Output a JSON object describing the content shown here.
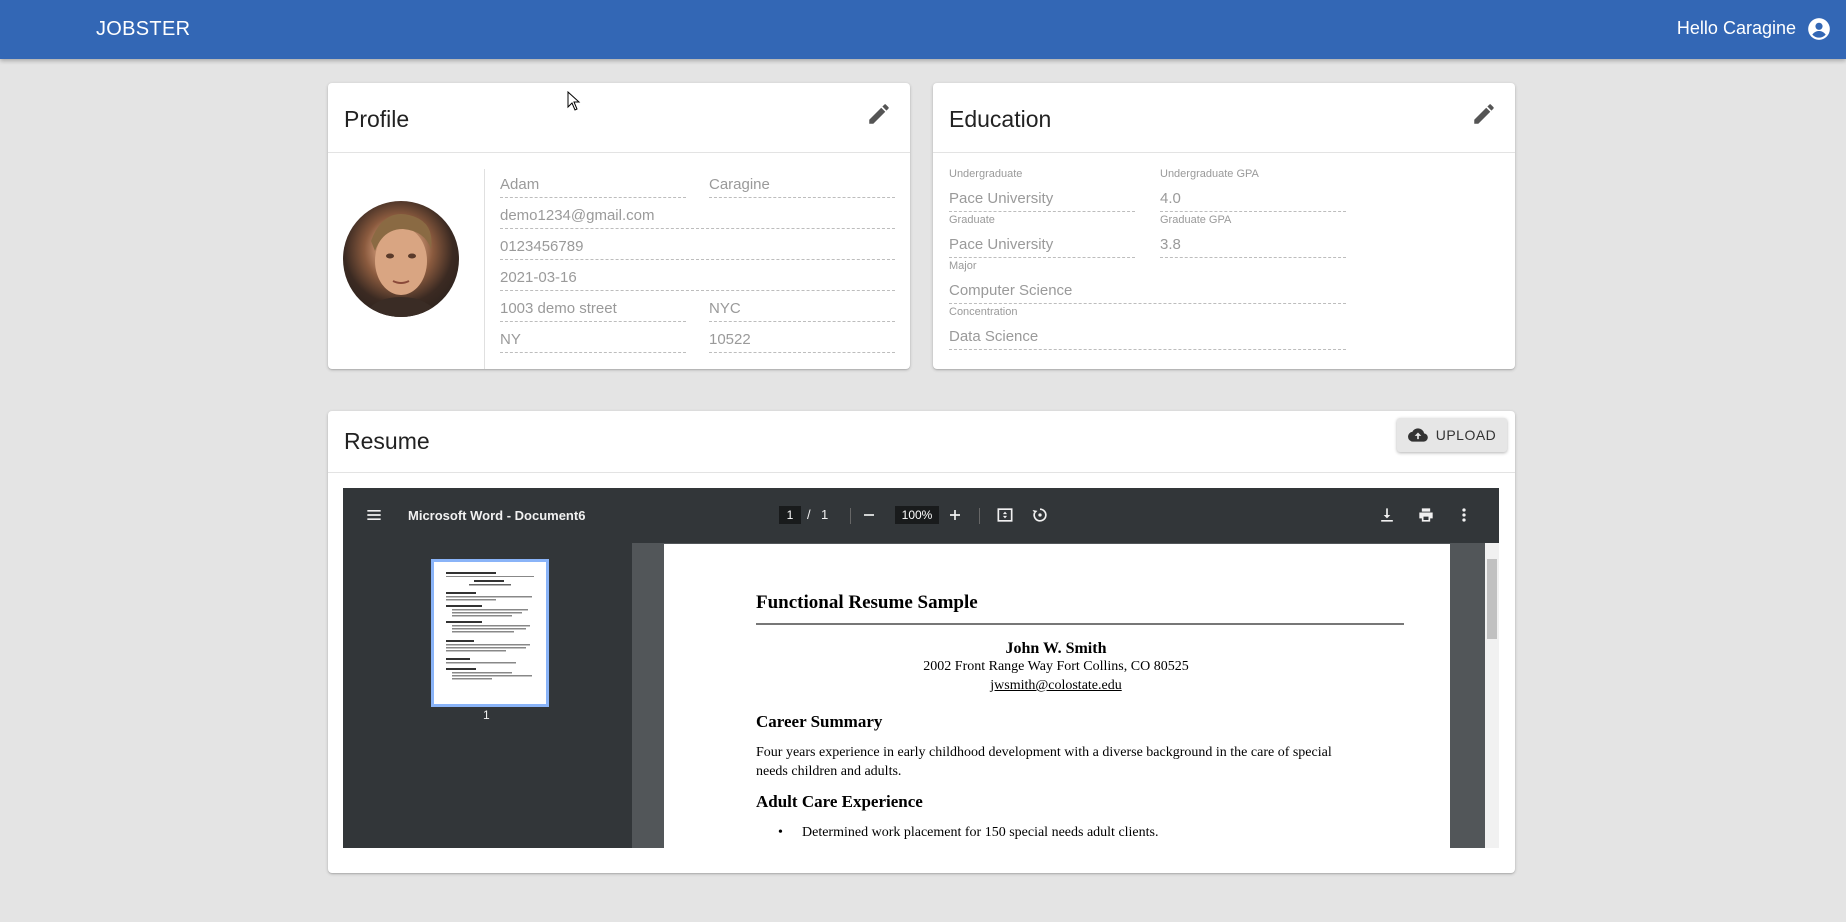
{
  "header": {
    "brand": "JOBSTER",
    "greeting": "Hello Caragine"
  },
  "profile": {
    "title": "Profile",
    "first_name": "Adam",
    "last_name": "Caragine",
    "email": "demo1234@gmail.com",
    "phone": "0123456789",
    "date": "2021-03-16",
    "street": "1003 demo street",
    "city": "NYC",
    "state": "NY",
    "zip": "10522"
  },
  "education": {
    "title": "Education",
    "undergrad_label": "Undergraduate",
    "undergrad_value": "Pace University",
    "undergrad_gpa_label": "Undergraduate GPA",
    "undergrad_gpa_value": "4.0",
    "grad_label": "Graduate",
    "grad_value": "Pace University",
    "grad_gpa_label": "Graduate GPA",
    "grad_gpa_value": "3.8",
    "major_label": "Major",
    "major_value": "Computer Science",
    "concentration_label": "Concentration",
    "concentration_value": "Data Science"
  },
  "resume": {
    "title": "Resume",
    "upload_label": "UPLOAD",
    "viewer": {
      "doc_title": "Microsoft Word - Document6",
      "page_current": "1",
      "page_sep": "/",
      "page_total": "1",
      "zoom": "100%",
      "thumb_page": "1"
    },
    "document": {
      "heading": "Functional Resume Sample",
      "name": "John W. Smith",
      "address": "2002 Front Range Way Fort Collins, CO 80525",
      "email": "jwsmith@colostate.edu",
      "section1": "Career Summary",
      "summary": "Four years experience in early childhood development with a diverse background in the care of special needs children and adults.",
      "section2": "Adult Care Experience",
      "bullet1": "Determined work placement for 150 special needs adult clients."
    }
  },
  "colors": {
    "appbar": "#3367b5",
    "background": "#e4e4e4",
    "viewer_toolbar": "#323639"
  }
}
